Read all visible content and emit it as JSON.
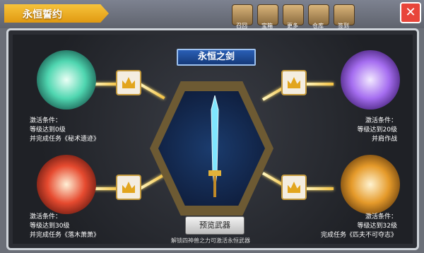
{
  "header": {
    "title": "永恒誓约",
    "close_label": "✕",
    "nav_labels": [
      "召回",
      "宝箱",
      "更多",
      "仓库",
      "签到"
    ]
  },
  "panel": {
    "banner": "永恒之剑",
    "preview_button": "预览武器",
    "hint": "解锁四神兽之力可激活永恒武器",
    "conditions": {
      "top_left": [
        "激活条件：",
        "等级达到0级",
        "并完成任务《秘术遗迹》"
      ],
      "top_right": [
        "激活条件：",
        "等级达到20级",
        "并肩作战"
      ],
      "bottom_left": [
        "激活条件：",
        "等级达到30级",
        "并完成任务《落木萧萧》"
      ],
      "bottom_right": [
        "激活条件：",
        "等级达到32级",
        "完成任务《匹夫不可夺志》"
      ]
    }
  },
  "colors": {
    "accent": "#e19a12",
    "banner": "#2a5fb5",
    "orb_green": "#4fd6b0",
    "orb_purple": "#a56df0",
    "orb_red": "#e64a2f",
    "orb_gold": "#e59a2a"
  },
  "icons": [
    "crown-icon",
    "close-icon",
    "sword-icon"
  ]
}
